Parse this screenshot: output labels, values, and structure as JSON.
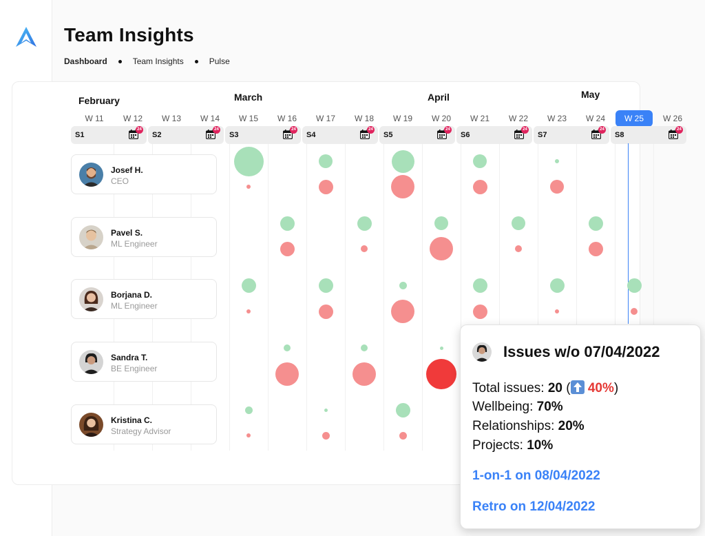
{
  "page": {
    "title": "Team Insights"
  },
  "breadcrumb": [
    "Dashboard",
    "Team Insights",
    "Pulse"
  ],
  "colors": {
    "accent": "#3a82f7",
    "positive": "#a8e0b9",
    "negative": "#f58f8f",
    "negative_strong": "#f03a3a",
    "badge": "#e0245e"
  },
  "sidebar": {
    "items": [
      {
        "icon": "home-icon"
      },
      {
        "icon": "team-icon"
      },
      {
        "icon": "analytics-icon"
      },
      {
        "icon": "clipboard-icon"
      },
      {
        "icon": "settings-icon"
      }
    ]
  },
  "months": [
    "February",
    "March",
    "April",
    "May"
  ],
  "weeks": [
    "W 11",
    "W 12",
    "W 13",
    "W 14",
    "W 15",
    "W 16",
    "W 17",
    "W 18",
    "W 19",
    "W 20",
    "W 21",
    "W 22",
    "W 23",
    "W 24",
    "W 25",
    "W 26"
  ],
  "active_week": "W 25",
  "sprints": [
    {
      "label": "S1",
      "badge": "24"
    },
    {
      "label": "S2",
      "badge": "24"
    },
    {
      "label": "S3",
      "badge": "24"
    },
    {
      "label": "S4",
      "badge": "24"
    },
    {
      "label": "S5",
      "badge": "24"
    },
    {
      "label": "S6",
      "badge": "24"
    },
    {
      "label": "S7",
      "badge": "24"
    },
    {
      "label": "S8",
      "badge": "24"
    }
  ],
  "people": [
    {
      "name": "Josef H.",
      "role": "CEO"
    },
    {
      "name": "Pavel S.",
      "role": "ML Engineer"
    },
    {
      "name": "Borjana D.",
      "role": "ML Engineer"
    },
    {
      "name": "Sandra T.",
      "role": "BE Engineer"
    },
    {
      "name": "Kristina C.",
      "role": "Strategy Advisor"
    }
  ],
  "tooltip": {
    "title": "Issues w/o 07/04/2022",
    "total_label": "Total issues: ",
    "total_value": "20",
    "total_change": "40%",
    "rows": [
      {
        "label": "Wellbeing: ",
        "value": "70%"
      },
      {
        "label": "Relationships: ",
        "value": "20%"
      },
      {
        "label": "Projects: ",
        "value": "10%"
      }
    ],
    "link_one_on_one": "1-on-1 on 08/04/2022",
    "link_retro": "Retro on 12/04/2022"
  }
}
